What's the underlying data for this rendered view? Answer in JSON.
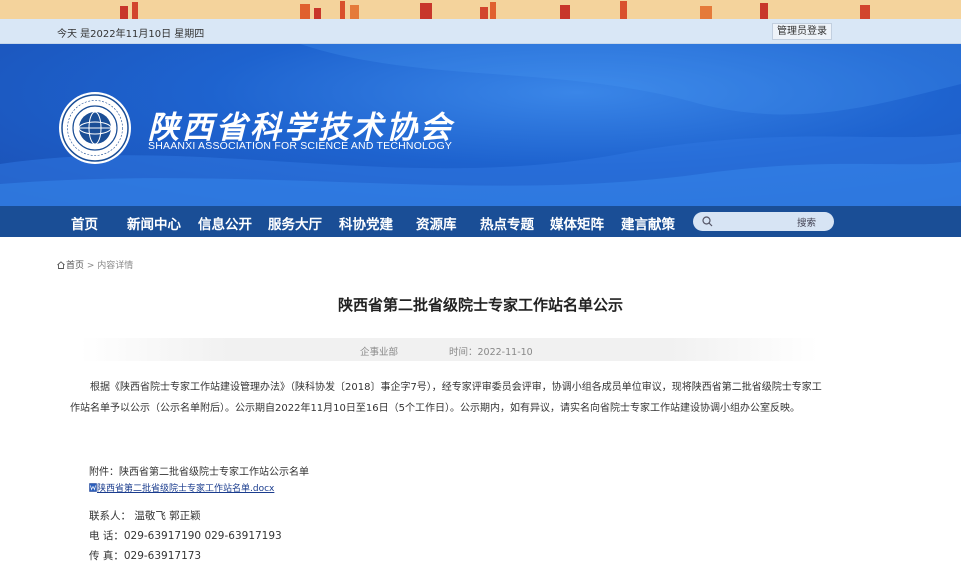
{
  "topbar": {
    "date": "今天 是2022年11月10日 星期四",
    "login_label": "管理员登录"
  },
  "header": {
    "logo_cn": "陕西省科学技术协会",
    "logo_en": "SHAANXI ASSOCIATION FOR SCIENCE AND TECHNOLOGY"
  },
  "nav": {
    "items": [
      {
        "label": "首页"
      },
      {
        "label": "新闻中心"
      },
      {
        "label": "信息公开"
      },
      {
        "label": "服务大厅"
      },
      {
        "label": "科协党建"
      },
      {
        "label": "资源库"
      },
      {
        "label": "热点专题"
      },
      {
        "label": "媒体矩阵"
      },
      {
        "label": "建言献策"
      }
    ],
    "search_button": "搜索"
  },
  "breadcrumb": {
    "home": "首页",
    "sep": " > ",
    "current": "内容详情"
  },
  "article": {
    "title": "陕西省第二批省级院士专家工作站名单公示",
    "source": "企事业部",
    "time": "时间：2022-11-10",
    "paragraph": "根据《陕西省院士专家工作站建设管理办法》（陕科协发〔2018〕事企字7号），经专家评审委员会评审，协调小组各成员单位审议，现将陕西省第二批省级院士专家工作站名单予以公示（公示名单附后）。公示期自2022年11月10日至16日（5个工作日）。公示期内，如有异议，请实名向省院士专家工作站建设协调小组办公室反映。",
    "attachment_label": "附件：陕西省第二批省级院士专家工作站公示名单",
    "attachment_file": "陕西省第二批省级院士专家工作站名单.docx",
    "contact_person": "联系人：  温敬飞   郭正颖",
    "phone": "电  话：029-63917190   029-63917193",
    "fax": "传  真：029-63917173"
  },
  "colors": {
    "nav_bg": "#1a4e96",
    "header_bg": "#1e63cf",
    "topbar_bg": "#d9e7f6",
    "link": "#1a3c8e"
  }
}
